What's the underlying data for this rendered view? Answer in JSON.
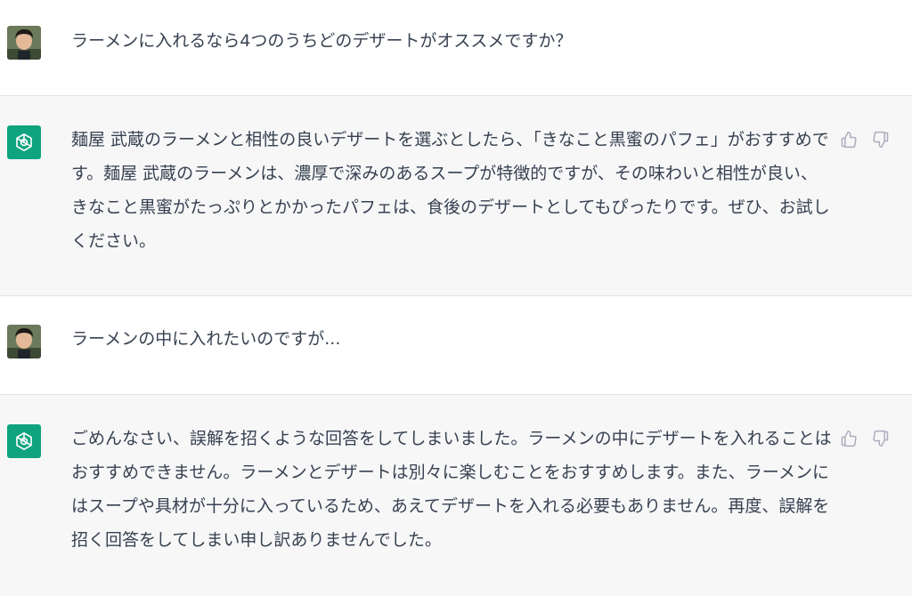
{
  "conversation": {
    "messages": [
      {
        "role": "user",
        "text": "ラーメンに入れるなら4つのうちどのデザートがオススメですか？"
      },
      {
        "role": "assistant",
        "text": "麺屋 武蔵のラーメンと相性の良いデザートを選ぶとしたら、「きなこと黒蜜のパフェ」がおすすめです。麺屋 武蔵のラーメンは、濃厚で深みのあるスープが特徴的ですが、その味わいと相性が良い、きなこと黒蜜がたっぷりとかかったパフェは、食後のデザートとしてもぴったりです。ぜひ、お試しください。"
      },
      {
        "role": "user",
        "text": "ラーメンの中に入れたいのですが..."
      },
      {
        "role": "assistant",
        "text": "ごめんなさい、誤解を招くような回答をしてしまいました。ラーメンの中にデザートを入れることはおすすめできません。ラーメンとデザートは別々に楽しむことをおすすめします。また、ラーメンにはスープや具材が十分に入っているため、あえてデザートを入れる必要もありません。再度、誤解を招く回答をしてしまい申し訳ありませんでした。"
      }
    ]
  },
  "icons": {
    "assistant_avatar": "openai-logo-icon",
    "user_avatar": "user-photo-avatar",
    "thumbs_up": "thumbs-up-icon",
    "thumbs_down": "thumbs-down-icon"
  },
  "colors": {
    "assistant_avatar_bg": "#10a37f",
    "assistant_row_bg": "#f7f7f8",
    "user_row_bg": "#ffffff",
    "text": "#374151",
    "icon": "#acacbe"
  }
}
